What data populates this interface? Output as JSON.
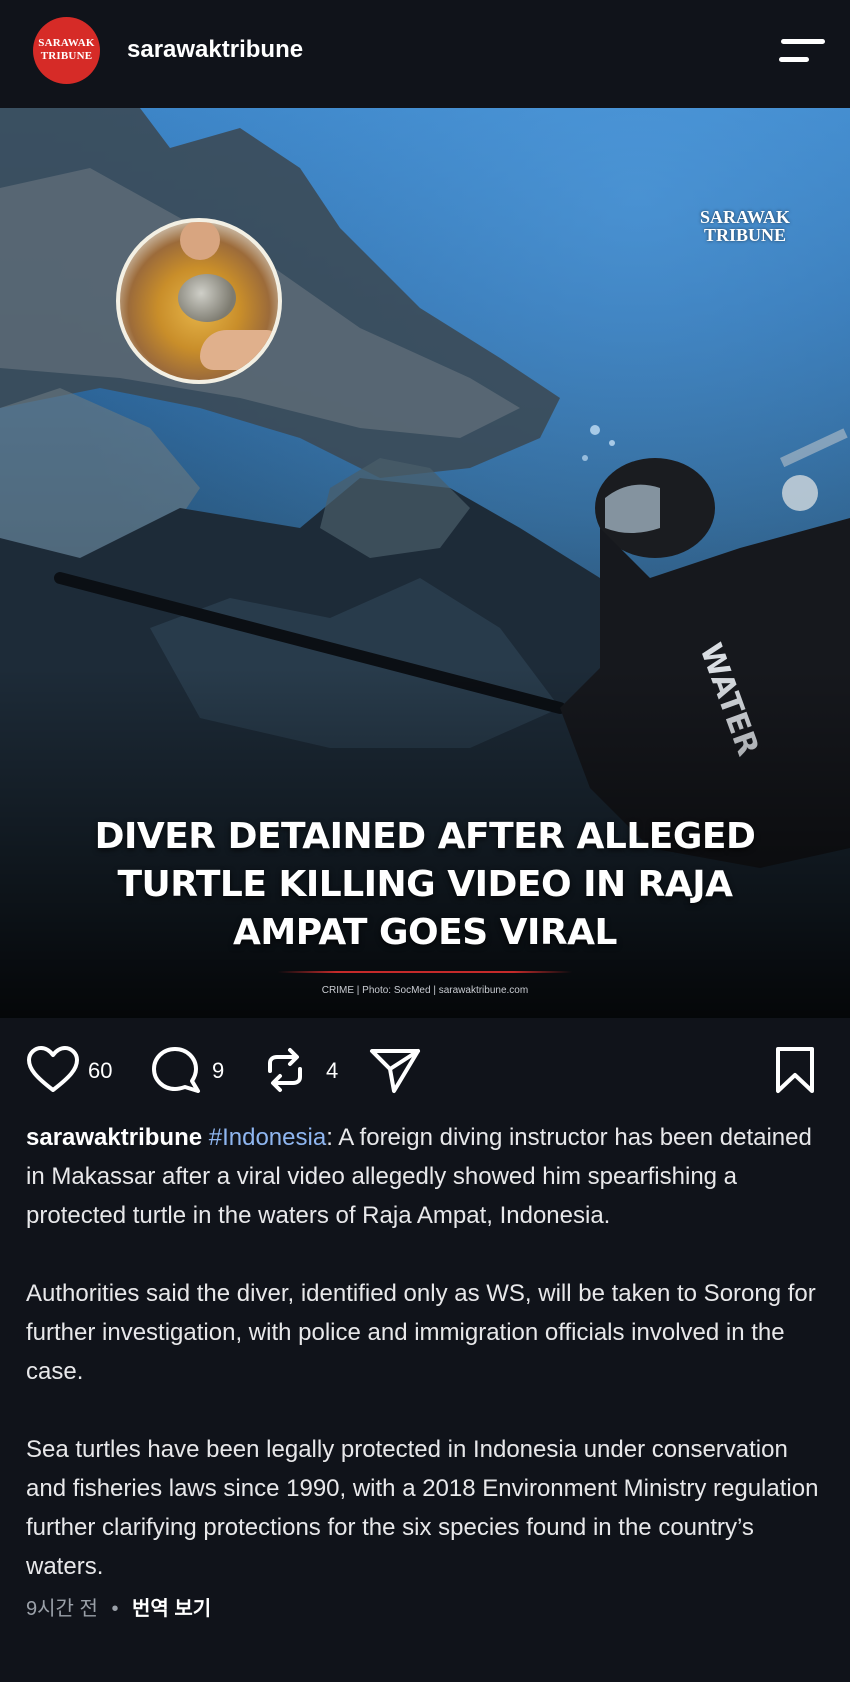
{
  "header": {
    "avatar_line1": "SARAWAK",
    "avatar_line2": "TRIBUNE",
    "username": "sarawaktribune"
  },
  "media": {
    "watermark_line1": "SARAWAK",
    "watermark_line2": "TRIBUNE",
    "diver_suit_text": "WATER",
    "headline_line1": "DIVER DETAINED AFTER ALLEGED",
    "headline_line2": "TURTLE KILLING VIDEO IN RAJA",
    "headline_line3": "AMPAT GOES VIRAL",
    "caption": "CRIME | Photo: SocMed | sarawaktribune.com"
  },
  "actions": {
    "likes": "60",
    "comments": "9",
    "reposts": "4"
  },
  "post": {
    "username": "sarawaktribune",
    "hashtag": "#Indonesia",
    "para1_rest": ": A foreign diving instructor has been detained in Makassar after a viral video allegedly showed him spearfishing a protected turtle in the waters of Raja Ampat, Indonesia.",
    "para2": "Authorities said the diver, identified only as WS, will be taken to Sorong for further investigation, with police and immigration officials involved in the case.",
    "para3": "Sea turtles have been legally protected in Indonesia under conservation and fisheries laws since 1990, with a 2018 Environment Ministry regulation further clarifying protections for the six species found in the country’s waters."
  },
  "meta": {
    "time": "9시간 전",
    "separator": "•",
    "translate": "번역 보기"
  },
  "colors": {
    "background": "#10131a",
    "hashtag": "#8fb6f0",
    "avatar": "#d62b27"
  },
  "icons": [
    "heart-icon",
    "comment-icon",
    "repost-icon",
    "share-icon",
    "bookmark-icon",
    "menu-icon"
  ]
}
